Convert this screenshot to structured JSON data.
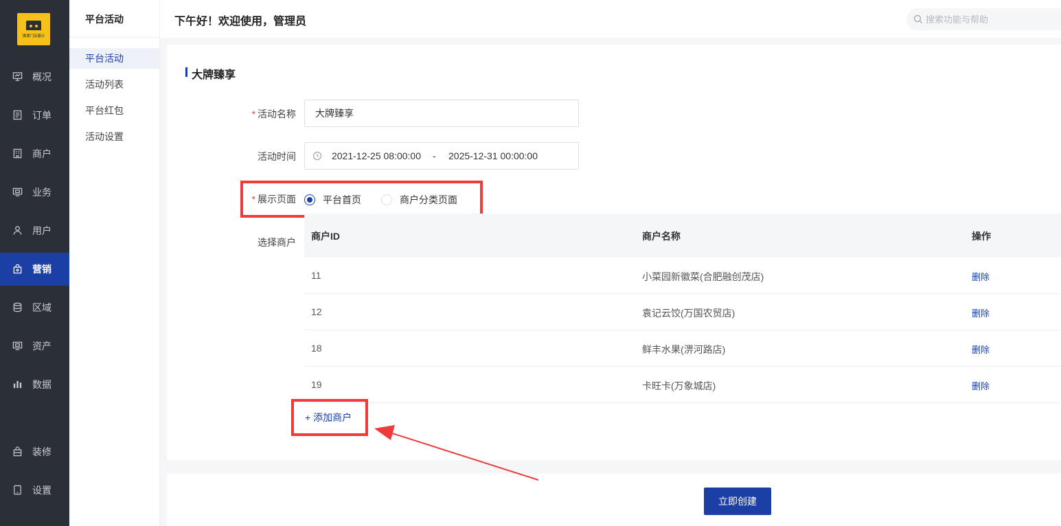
{
  "logo": {
    "text": "摸摸门店展示"
  },
  "sidebar": {
    "items": [
      {
        "label": "概况",
        "icon": "chart-board-icon"
      },
      {
        "label": "订单",
        "icon": "document-list-icon"
      },
      {
        "label": "商户",
        "icon": "building-icon"
      },
      {
        "label": "业务",
        "icon": "monitor-icon"
      },
      {
        "label": "用户",
        "icon": "user-icon"
      },
      {
        "label": "营销",
        "icon": "shopping-bag-icon",
        "active": true
      },
      {
        "label": "区域",
        "icon": "database-icon"
      },
      {
        "label": "资产",
        "icon": "wallet-icon"
      },
      {
        "label": "数据",
        "icon": "bar-chart-icon"
      },
      {
        "label": "装修",
        "icon": "bag-icon"
      },
      {
        "label": "设置",
        "icon": "tablet-icon"
      }
    ]
  },
  "subnav": {
    "title": "平台活动",
    "items": [
      {
        "label": "平台活动",
        "active": true
      },
      {
        "label": "活动列表"
      },
      {
        "label": "平台红包"
      },
      {
        "label": "活动设置"
      }
    ]
  },
  "header": {
    "greeting": "下午好！欢迎使用，管理员",
    "search_placeholder": "搜索功能与帮助"
  },
  "form": {
    "section_title": "大牌臻享",
    "name_label": "活动名称",
    "name_value": "大牌臻享",
    "time_label": "活动时间",
    "time_start": "2021-12-25 08:00:00",
    "time_separator": "-",
    "time_end": "2025-12-31 00:00:00",
    "display_label": "展示页面",
    "display_options": [
      {
        "label": "平台首页",
        "checked": true
      },
      {
        "label": "商户分类页面",
        "checked": false
      }
    ],
    "merchant_label": "选择商户",
    "table": {
      "columns": [
        "商户ID",
        "商户名称",
        "操作"
      ],
      "rows": [
        {
          "id": "11",
          "name": "小菜园新徽菜(合肥融创茂店)",
          "action": "删除"
        },
        {
          "id": "12",
          "name": "袁记云饺(万国农贸店)",
          "action": "删除"
        },
        {
          "id": "18",
          "name": "鲜丰水果(淠河路店)",
          "action": "删除"
        },
        {
          "id": "19",
          "name": "卡旺卡(万象城店)",
          "action": "删除"
        }
      ]
    },
    "add_merchant": "+ 添加商户"
  },
  "footer": {
    "create_label": "立即创建"
  },
  "colors": {
    "sidebar_bg": "#2b2f37",
    "accent": "#1b3fa5",
    "highlight": "#ee3b3b",
    "logo_bg": "#f6c21a"
  }
}
